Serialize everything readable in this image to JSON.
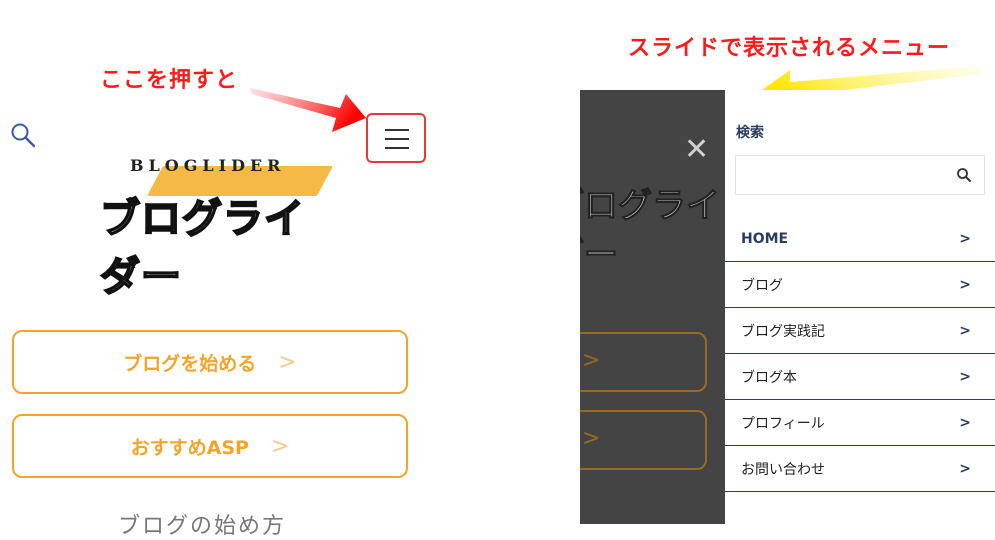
{
  "annotations": {
    "press_here": "ここを押すと",
    "slide_menu": "スライドで表示されるメニュー"
  },
  "left_view": {
    "logo": {
      "english": "BLOGLIDER",
      "japanese": "ブログライダー"
    },
    "buttons": [
      {
        "label": "ブログを始める"
      },
      {
        "label": "おすすめASP"
      }
    ],
    "cut_heading": "ブログの始め方"
  },
  "right_view": {
    "drawer": {
      "title": "検索",
      "menu": [
        {
          "label": "HOME"
        },
        {
          "label": "ブログ"
        },
        {
          "label": "ブログ実践記"
        },
        {
          "label": "ブログ本"
        },
        {
          "label": "プロフィール"
        },
        {
          "label": "お問い合わせ"
        }
      ]
    }
  },
  "icons": {
    "search": "search-icon",
    "menu": "hamburger-icon",
    "close": "close-icon",
    "chevron": "chevron-right-icon"
  },
  "colors": {
    "annotation_red": "#ff1a1a",
    "accent_orange": "#f4a42a",
    "menu_navy": "#2c3e60",
    "overlay_dark": "#444444",
    "arrow_yellow": "#ffe600"
  }
}
